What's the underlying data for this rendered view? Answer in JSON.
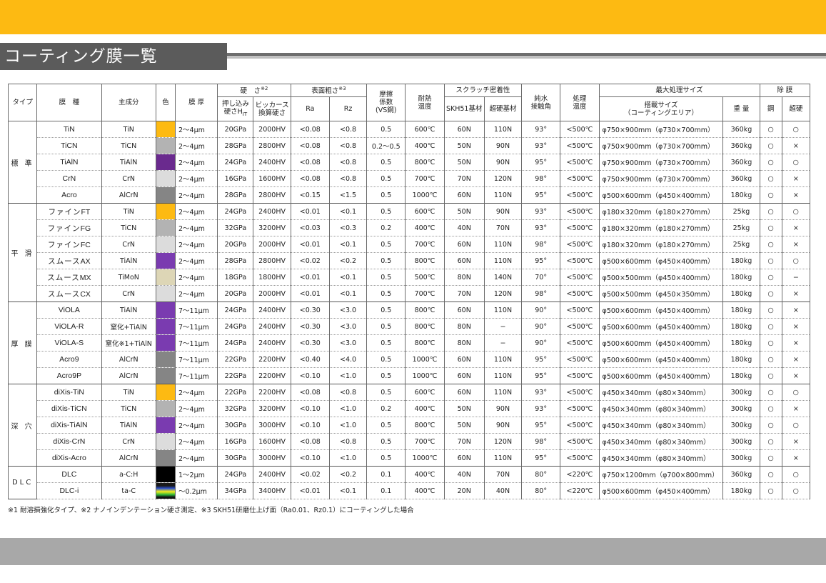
{
  "page": {
    "title": "コーティング膜一覧",
    "footnote": "※1 耐溶損強化タイプ、※2 ナノインデンテーション硬さ測定、※3 SKH51研磨仕上げ面（Ra0.01、Rz0.1）にコーティングした場合"
  },
  "colors": {
    "gold": "#fdba12",
    "lightgray": "#b3b3b3",
    "purple": "#6a2a8e",
    "verylight": "#dcdcdc",
    "darkgray": "#858585",
    "beige": "#ddd6b6",
    "black": "#000000",
    "violet": "#7a3bb0",
    "gradient": [
      "#1a1a1a",
      "#2b4fcf",
      "#f5ef1a",
      "#29b23a",
      "#111111"
    ]
  },
  "headers": {
    "type": "タイプ",
    "film": "膜　種",
    "component": "主成分",
    "color": "色",
    "thickness": "膜 厚",
    "hardness": "硬　さ",
    "hardness_note": "※2",
    "hardness_indent_a": "押し込み",
    "hardness_indent_b": "硬さH",
    "hardness_indent_sub": "IT",
    "vickers_a": "ビッカース",
    "vickers_b": "換算硬さ",
    "roughness": "表面粗さ",
    "roughness_note": "※3",
    "ra": "Ra",
    "rz": "Rz",
    "friction_a": "摩擦",
    "friction_b": "係数",
    "friction_c": "(VS鋼)",
    "heat_a": "耐熱",
    "heat_b": "温度",
    "scratch": "スクラッチ密着性",
    "skh": "SKH51基材",
    "carbide": "超硬基材",
    "contact_a": "純水",
    "contact_b": "接触角",
    "proc_a": "処理",
    "proc_b": "温度",
    "maxsize": "最大処理サイズ",
    "load_a": "搭載サイズ",
    "load_b": "（コーティングエリア）",
    "weight": "重 量",
    "removal": "除 膜",
    "steel": "鋼",
    "hard": "超硬"
  },
  "groups": [
    {
      "type": "標 準",
      "rows": [
        {
          "name": "TiN",
          "pre": "",
          "comp": "TiN",
          "color": "gold",
          "thick": "2〜4μm",
          "hit": "20GPa",
          "hv": "2000HV",
          "ra": "<0.08",
          "rz": "<0.8",
          "mu": "0.5",
          "heat": "600℃",
          "skh": "60N",
          "carb": "110N",
          "angle": "93°",
          "proc": "<500℃",
          "size": "φ750×900mm（φ730×700mm）",
          "wt": "360kg",
          "steel": "○",
          "hard": "○"
        },
        {
          "name": "TiCN",
          "pre": "",
          "comp": "TiCN",
          "color": "lightgray",
          "thick": "2〜4μm",
          "hit": "28GPa",
          "hv": "2800HV",
          "ra": "<0.08",
          "rz": "<0.8",
          "mu": "0.2〜0.5",
          "heat": "400℃",
          "skh": "50N",
          "carb": "90N",
          "angle": "93°",
          "proc": "<500℃",
          "size": "φ750×900mm（φ730×700mm）",
          "wt": "360kg",
          "steel": "○",
          "hard": "×"
        },
        {
          "name": "TiAlN",
          "pre": "",
          "comp": "TiAlN",
          "color": "purple",
          "thick": "2〜4μm",
          "hit": "24GPa",
          "hv": "2400HV",
          "ra": "<0.08",
          "rz": "<0.8",
          "mu": "0.5",
          "heat": "800℃",
          "skh": "50N",
          "carb": "90N",
          "angle": "95°",
          "proc": "<500℃",
          "size": "φ750×900mm（φ730×700mm）",
          "wt": "360kg",
          "steel": "○",
          "hard": "○"
        },
        {
          "name": "CrN",
          "pre": "",
          "comp": "CrN",
          "color": "verylight",
          "thick": "2〜4μm",
          "hit": "16GPa",
          "hv": "1600HV",
          "ra": "<0.08",
          "rz": "<0.8",
          "mu": "0.5",
          "heat": "700℃",
          "skh": "70N",
          "carb": "120N",
          "angle": "98°",
          "proc": "<500℃",
          "size": "φ750×900mm（φ730×700mm）",
          "wt": "360kg",
          "steel": "○",
          "hard": "×"
        },
        {
          "name": "Acro",
          "pre": "",
          "comp": "AlCrN",
          "color": "darkgray",
          "thick": "2〜4μm",
          "hit": "28GPa",
          "hv": "2800HV",
          "ra": "<0.15",
          "rz": "<1.5",
          "mu": "0.5",
          "heat": "1000℃",
          "skh": "60N",
          "carb": "110N",
          "angle": "95°",
          "proc": "<500℃",
          "size": "φ500×600mm（φ450×400mm）",
          "wt": "180kg",
          "steel": "○",
          "hard": "×"
        }
      ]
    },
    {
      "type": "平 滑",
      "rows": [
        {
          "name": "FT",
          "pre": "ファイン",
          "comp": "TiN",
          "color": "gold",
          "thick": "2〜4μm",
          "hit": "24GPa",
          "hv": "2400HV",
          "ra": "<0.01",
          "rz": "<0.1",
          "mu": "0.5",
          "heat": "600℃",
          "skh": "50N",
          "carb": "90N",
          "angle": "93°",
          "proc": "<500℃",
          "size": "φ180×320mm（φ180×270mm）",
          "wt": "25kg",
          "steel": "○",
          "hard": "○"
        },
        {
          "name": "FG",
          "pre": "ファイン",
          "comp": "TiCN",
          "color": "lightgray",
          "thick": "2〜4μm",
          "hit": "32GPa",
          "hv": "3200HV",
          "ra": "<0.03",
          "rz": "<0.3",
          "mu": "0.2",
          "heat": "400℃",
          "skh": "40N",
          "carb": "70N",
          "angle": "93°",
          "proc": "<500℃",
          "size": "φ180×320mm（φ180×270mm）",
          "wt": "25kg",
          "steel": "○",
          "hard": "×"
        },
        {
          "name": "FC",
          "pre": "ファイン",
          "comp": "CrN",
          "color": "verylight",
          "thick": "2〜4μm",
          "hit": "20GPa",
          "hv": "2000HV",
          "ra": "<0.01",
          "rz": "<0.1",
          "mu": "0.5",
          "heat": "700℃",
          "skh": "60N",
          "carb": "110N",
          "angle": "98°",
          "proc": "<500℃",
          "size": "φ180×320mm（φ180×270mm）",
          "wt": "25kg",
          "steel": "○",
          "hard": "×"
        },
        {
          "name": "AX",
          "pre": "スムース",
          "comp": "TiAlN",
          "color": "violet",
          "thick": "2〜4μm",
          "hit": "28GPa",
          "hv": "2800HV",
          "ra": "<0.02",
          "rz": "<0.2",
          "mu": "0.5",
          "heat": "800℃",
          "skh": "60N",
          "carb": "110N",
          "angle": "95°",
          "proc": "<500℃",
          "size": "φ500×600mm（φ450×400mm）",
          "wt": "180kg",
          "steel": "○",
          "hard": "○"
        },
        {
          "name": "MX",
          "pre": "スムース",
          "comp": "TiMoN",
          "color": "beige",
          "thick": "2〜4μm",
          "hit": "18GPa",
          "hv": "1800HV",
          "ra": "<0.01",
          "rz": "<0.1",
          "mu": "0.5",
          "heat": "500℃",
          "skh": "80N",
          "carb": "140N",
          "angle": "70°",
          "proc": "<500℃",
          "size": "φ500×500mm（φ450×400mm）",
          "wt": "180kg",
          "steel": "○",
          "hard": "−"
        },
        {
          "name": "CX",
          "pre": "スムース",
          "comp": "CrN",
          "color": "verylight",
          "thick": "2〜4μm",
          "hit": "20GPa",
          "hv": "2000HV",
          "ra": "<0.01",
          "rz": "<0.1",
          "mu": "0.5",
          "heat": "700℃",
          "skh": "70N",
          "carb": "120N",
          "angle": "98°",
          "proc": "<500℃",
          "size": "φ500×500mm（φ450×350mm）",
          "wt": "180kg",
          "steel": "○",
          "hard": "×"
        }
      ]
    },
    {
      "type": "厚 膜",
      "rows": [
        {
          "name": "ViOLA",
          "pre": "",
          "comp": "TiAlN",
          "color": "violet",
          "thick": "7〜11μm",
          "hit": "24GPa",
          "hv": "2400HV",
          "ra": "<0.30",
          "rz": "<3.0",
          "mu": "0.5",
          "heat": "800℃",
          "skh": "60N",
          "carb": "110N",
          "angle": "90°",
          "proc": "<500℃",
          "size": "φ500×600mm（φ450×400mm）",
          "wt": "180kg",
          "steel": "○",
          "hard": "×"
        },
        {
          "name": "ViOLA-R",
          "pre": "",
          "comp": "窒化+TiAlN",
          "color": "violet",
          "thick": "7〜11μm",
          "hit": "24GPa",
          "hv": "2400HV",
          "ra": "<0.30",
          "rz": "<3.0",
          "mu": "0.5",
          "heat": "800℃",
          "skh": "80N",
          "carb": "−",
          "angle": "90°",
          "proc": "<500℃",
          "size": "φ500×600mm（φ450×400mm）",
          "wt": "180kg",
          "steel": "○",
          "hard": "×"
        },
        {
          "name": "ViOLA-S",
          "pre": "",
          "comp": "窒化※1+TiAlN",
          "color": "violet",
          "thick": "7〜11μm",
          "hit": "24GPa",
          "hv": "2400HV",
          "ra": "<0.30",
          "rz": "<3.0",
          "mu": "0.5",
          "heat": "800℃",
          "skh": "80N",
          "carb": "−",
          "angle": "90°",
          "proc": "<500℃",
          "size": "φ500×600mm（φ450×400mm）",
          "wt": "180kg",
          "steel": "○",
          "hard": "×"
        },
        {
          "name": "Acro9",
          "pre": "",
          "comp": "AlCrN",
          "color": "darkgray",
          "thick": "7〜11μm",
          "hit": "22GPa",
          "hv": "2200HV",
          "ra": "<0.40",
          "rz": "<4.0",
          "mu": "0.5",
          "heat": "1000℃",
          "skh": "60N",
          "carb": "110N",
          "angle": "95°",
          "proc": "<500℃",
          "size": "φ500×600mm（φ450×400mm）",
          "wt": "180kg",
          "steel": "○",
          "hard": "×"
        },
        {
          "name": "Acro9P",
          "pre": "",
          "comp": "AlCrN",
          "color": "darkgray",
          "thick": "7〜11μm",
          "hit": "22GPa",
          "hv": "2200HV",
          "ra": "<0.10",
          "rz": "<1.0",
          "mu": "0.5",
          "heat": "1000℃",
          "skh": "60N",
          "carb": "110N",
          "angle": "95°",
          "proc": "<500℃",
          "size": "φ500×600mm（φ450×400mm）",
          "wt": "180kg",
          "steel": "○",
          "hard": "×"
        }
      ]
    },
    {
      "type": "深 穴",
      "rows": [
        {
          "name": "diXis-TiN",
          "pre": "",
          "comp": "TiN",
          "color": "gold",
          "thick": "2〜4μm",
          "hit": "22GPa",
          "hv": "2200HV",
          "ra": "<0.08",
          "rz": "<0.8",
          "mu": "0.5",
          "heat": "600℃",
          "skh": "60N",
          "carb": "110N",
          "angle": "93°",
          "proc": "<500℃",
          "size": "φ450×340mm（φ80×340mm）",
          "wt": "300kg",
          "steel": "○",
          "hard": "○"
        },
        {
          "name": "diXis-TiCN",
          "pre": "",
          "comp": "TiCN",
          "color": "lightgray",
          "thick": "2〜4μm",
          "hit": "32GPa",
          "hv": "3200HV",
          "ra": "<0.10",
          "rz": "<1.0",
          "mu": "0.2",
          "heat": "400℃",
          "skh": "50N",
          "carb": "90N",
          "angle": "93°",
          "proc": "<500℃",
          "size": "φ450×340mm（φ80×340mm）",
          "wt": "300kg",
          "steel": "○",
          "hard": "×"
        },
        {
          "name": "diXis-TiAlN",
          "pre": "",
          "comp": "TiAlN",
          "color": "violet",
          "thick": "2〜4μm",
          "hit": "30GPa",
          "hv": "3000HV",
          "ra": "<0.10",
          "rz": "<1.0",
          "mu": "0.5",
          "heat": "800℃",
          "skh": "50N",
          "carb": "90N",
          "angle": "95°",
          "proc": "<500℃",
          "size": "φ450×340mm（φ80×340mm）",
          "wt": "300kg",
          "steel": "○",
          "hard": "○"
        },
        {
          "name": "diXis-CrN",
          "pre": "",
          "comp": "CrN",
          "color": "verylight",
          "thick": "2〜4μm",
          "hit": "16GPa",
          "hv": "1600HV",
          "ra": "<0.08",
          "rz": "<0.8",
          "mu": "0.5",
          "heat": "700℃",
          "skh": "70N",
          "carb": "120N",
          "angle": "98°",
          "proc": "<500℃",
          "size": "φ450×340mm（φ80×340mm）",
          "wt": "300kg",
          "steel": "○",
          "hard": "×"
        },
        {
          "name": "diXis-Acro",
          "pre": "",
          "comp": "AlCrN",
          "color": "darkgray",
          "thick": "2〜4μm",
          "hit": "30GPa",
          "hv": "3000HV",
          "ra": "<0.10",
          "rz": "<1.0",
          "mu": "0.5",
          "heat": "1000℃",
          "skh": "60N",
          "carb": "110N",
          "angle": "95°",
          "proc": "<500℃",
          "size": "φ450×340mm（φ80×340mm）",
          "wt": "300kg",
          "steel": "○",
          "hard": "×"
        }
      ]
    },
    {
      "type": "DLC",
      "rows": [
        {
          "name": "DLC",
          "pre": "",
          "comp": "a-C:H",
          "color": "black",
          "thick": "1〜2μm",
          "hit": "24GPa",
          "hv": "2400HV",
          "ra": "<0.02",
          "rz": "<0.2",
          "mu": "0.1",
          "heat": "400℃",
          "skh": "40N",
          "carb": "70N",
          "angle": "80°",
          "proc": "<220℃",
          "size": "φ750×1200mm（φ700×800mm）",
          "wt": "360kg",
          "steel": "○",
          "hard": "○"
        },
        {
          "name": "DLC-i",
          "pre": "",
          "comp": "ta-C",
          "color": "gradient",
          "thick": "〜0.2μm",
          "hit": "34GPa",
          "hv": "3400HV",
          "ra": "<0.01",
          "rz": "<0.1",
          "mu": "0.1",
          "heat": "400℃",
          "skh": "20N",
          "carb": "40N",
          "angle": "80°",
          "proc": "<220℃",
          "size": "φ500×600mm（φ450×400mm）",
          "wt": "180kg",
          "steel": "○",
          "hard": "○"
        }
      ]
    }
  ]
}
